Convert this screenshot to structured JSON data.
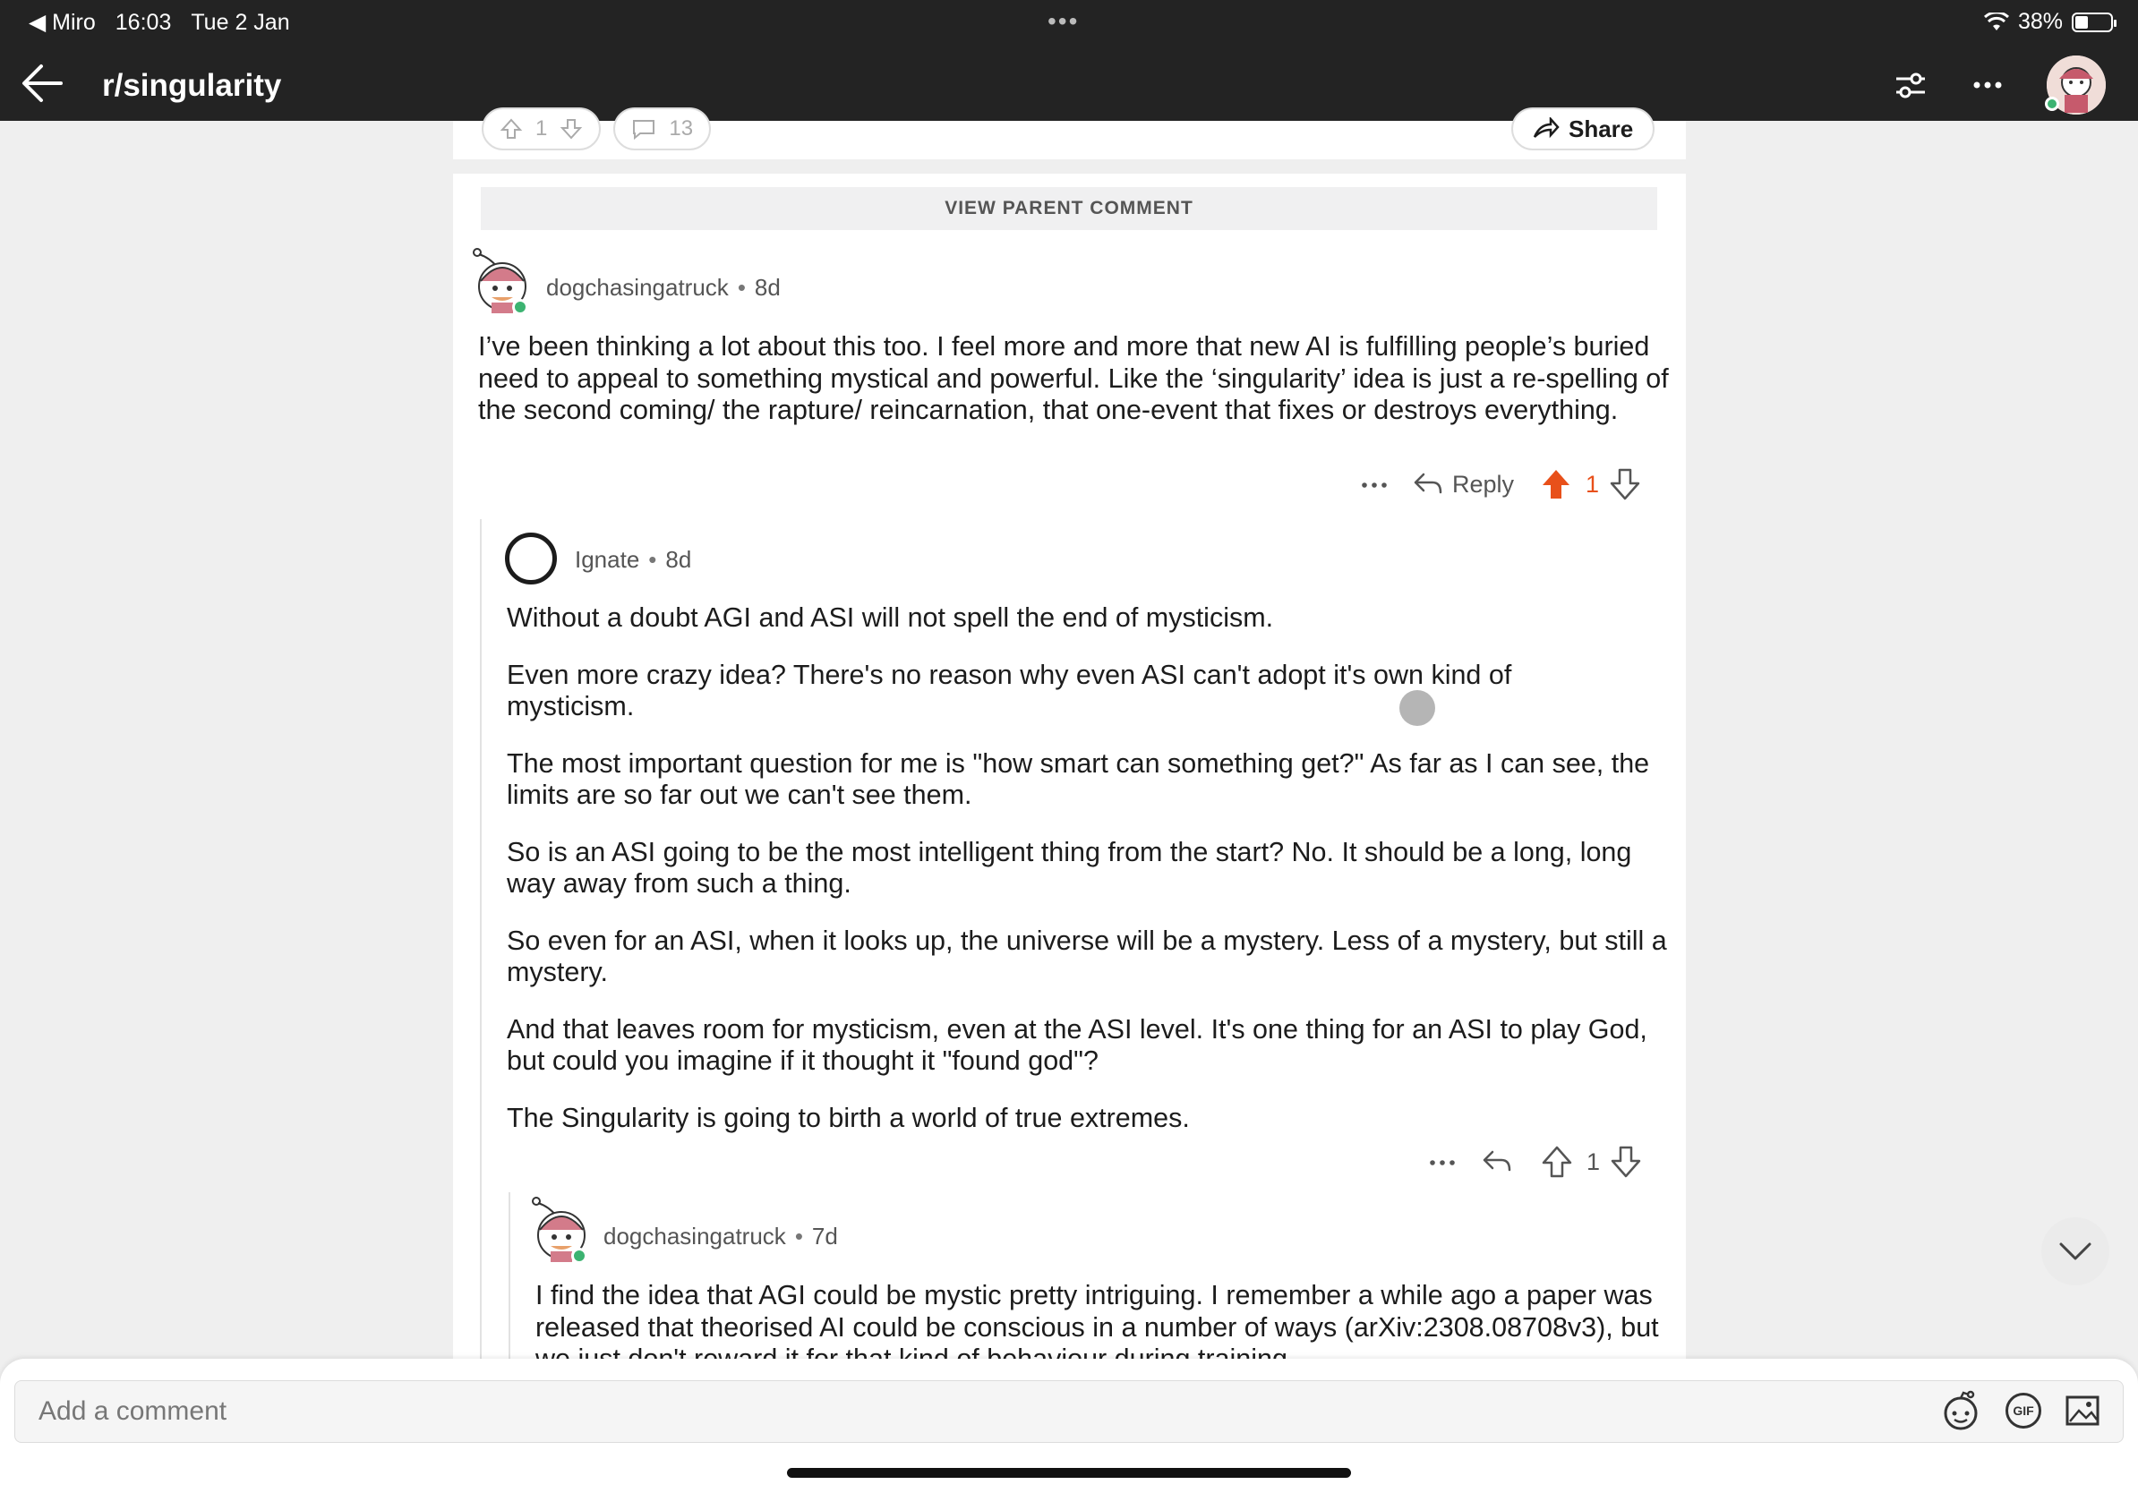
{
  "status_bar": {
    "back_app": "Miro",
    "time": "16:03",
    "date": "Tue 2 Jan",
    "battery": "38%",
    "battery_level": 0.38
  },
  "header": {
    "title": "r/singularity"
  },
  "post_actions": {
    "upvotes": "1",
    "comments": "13",
    "share": "Share"
  },
  "view_parent": "VIEW PARENT COMMENT",
  "comments": [
    {
      "user": "dogchasingatruck",
      "age": "8d",
      "body": [
        "I’ve been thinking a lot about this too. I feel more and more that new AI is fulfilling people’s buried need to appeal to something mystical and powerful. Like the ‘singularity’ idea is just a re-spelling of the second coming/ the rapture/ reincarnation, that one-event that fixes or destroys everything."
      ],
      "reply_label": "Reply",
      "score": "1"
    },
    {
      "user": "Ignate",
      "age": "8d",
      "body": [
        "Without a doubt AGI and ASI will not spell the end of mysticism.",
        "Even more crazy idea? There's no reason why even ASI can't adopt it's own kind of mysticism.",
        "The most important question for me is \"how smart can something get?\" As far as I can see, the limits are so far out we can't see them.",
        "So is an ASI going to be the most intelligent thing from the start? No. It should be a long, long way away from such a thing.",
        "So even for an ASI, when it looks up, the universe will be a mystery. Less of a mystery, but still a mystery.",
        "And that leaves room for mysticism, even at the ASI level. It's one thing for an ASI to play God, but could you imagine if it thought it \"found god\"?",
        "The Singularity is going to birth a world of true extremes."
      ],
      "score": "1"
    },
    {
      "user": "dogchasingatruck",
      "age": "7d",
      "body": [
        "I find the idea that AGI could be mystic pretty intriguing. I remember a while ago a paper was released that theorised AI could be conscious in a number of ways (arXiv:2308.08708v3), but we just don't reward it for that kind of behaviour during training"
      ]
    }
  ],
  "comment_bar": {
    "placeholder": "Add a comment",
    "gif_label": "GIF"
  },
  "colors": {
    "upvote": "#e8501a",
    "online": "#3cb371",
    "header_bg": "#232323"
  }
}
